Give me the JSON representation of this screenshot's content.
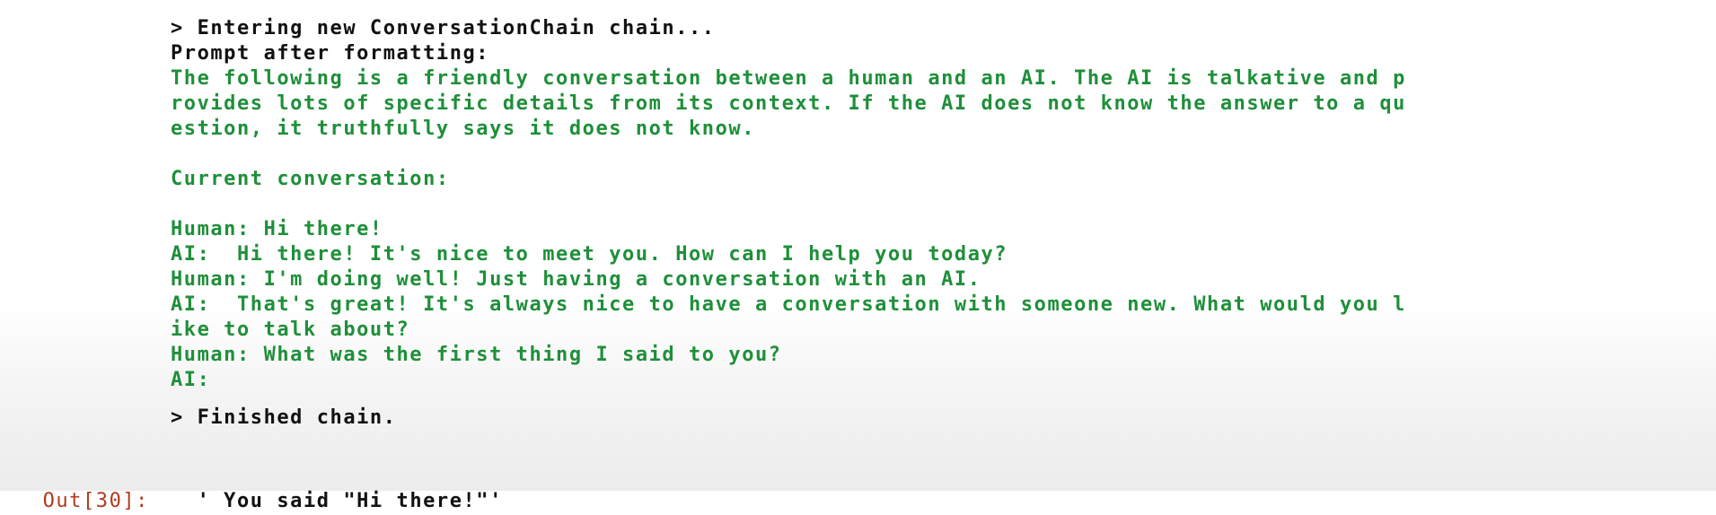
{
  "chain_output": {
    "entering": "> Entering new ConversationChain chain...",
    "prompt_label": "Prompt after formatting:",
    "prompt_lines": [
      "The following is a friendly conversation between a human and an AI. The AI is talkative and p",
      "rovides lots of specific details from its context. If the AI does not know the answer to a qu",
      "estion, it truthfully says it does not know."
    ],
    "current_conversation_label": "Current conversation:",
    "conversation_lines": [
      "Human: Hi there!",
      "AI:  Hi there! It's nice to meet you. How can I help you today?",
      "Human: I'm doing well! Just having a conversation with an AI.",
      "AI:  That's great! It's always nice to have a conversation with someone new. What would you l",
      "ike to talk about?",
      "Human: What was the first thing I said to you?",
      "AI:"
    ],
    "finished": "> Finished chain."
  },
  "cell_output": {
    "prompt": "Out[30]:",
    "value": "' You said \"Hi there!\"'"
  },
  "colors": {
    "prompt_text": "#1f8f3a",
    "out_prompt": "#b03a1a",
    "default_text": "#111111"
  }
}
